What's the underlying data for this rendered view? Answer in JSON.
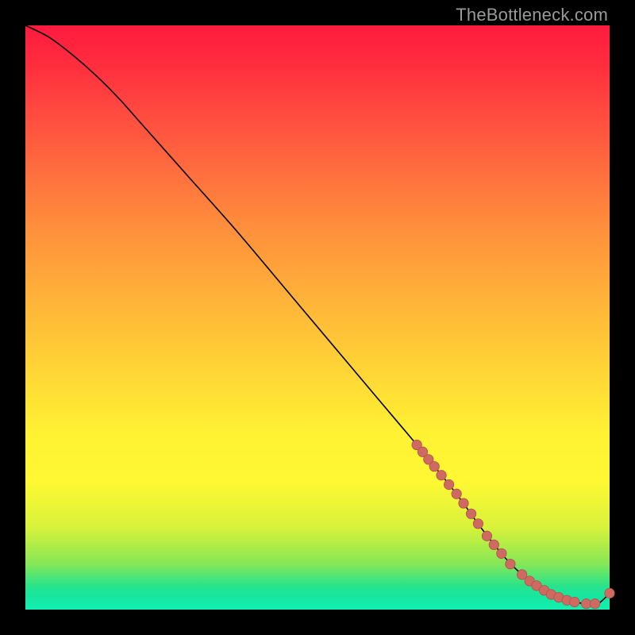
{
  "watermark": "TheBottleneck.com",
  "colors": {
    "curve": "#000000",
    "marker_fill": "#cf6a62",
    "marker_stroke": "#b15049",
    "bg_black": "#000000"
  },
  "chart_data": {
    "type": "line",
    "title": "",
    "xlabel": "",
    "ylabel": "",
    "xlim": [
      0,
      100
    ],
    "ylim": [
      0,
      100
    ],
    "grid": false,
    "legend": false,
    "series": [
      {
        "name": "bottleneck-curve",
        "x": [
          0,
          4,
          8,
          12,
          16,
          20,
          28,
          36,
          44,
          52,
          60,
          68,
          74,
          78,
          82,
          85,
          88,
          90,
          92,
          94,
          96,
          98,
          100
        ],
        "y": [
          100,
          98,
          95,
          91.5,
          87.5,
          83,
          74,
          65,
          55.5,
          46,
          36.5,
          27,
          19.5,
          14,
          9,
          6,
          3.8,
          2.6,
          1.8,
          1.3,
          1.0,
          1.0,
          2.8
        ]
      }
    ],
    "markers": [
      {
        "x": 67.0,
        "y": 28.2
      },
      {
        "x": 68.0,
        "y": 27.0
      },
      {
        "x": 69.0,
        "y": 25.7
      },
      {
        "x": 70.0,
        "y": 24.5
      },
      {
        "x": 71.2,
        "y": 23.0
      },
      {
        "x": 72.5,
        "y": 21.4
      },
      {
        "x": 73.8,
        "y": 19.8
      },
      {
        "x": 75.0,
        "y": 18.2
      },
      {
        "x": 76.3,
        "y": 16.4
      },
      {
        "x": 77.5,
        "y": 14.7
      },
      {
        "x": 79.0,
        "y": 12.6
      },
      {
        "x": 80.2,
        "y": 11.1
      },
      {
        "x": 81.5,
        "y": 9.6
      },
      {
        "x": 83.0,
        "y": 7.8
      },
      {
        "x": 85.0,
        "y": 6.0
      },
      {
        "x": 86.3,
        "y": 4.9
      },
      {
        "x": 87.5,
        "y": 4.1
      },
      {
        "x": 88.8,
        "y": 3.3
      },
      {
        "x": 90.0,
        "y": 2.6
      },
      {
        "x": 91.3,
        "y": 2.1
      },
      {
        "x": 92.7,
        "y": 1.6
      },
      {
        "x": 94.0,
        "y": 1.3
      },
      {
        "x": 96.0,
        "y": 1.0
      },
      {
        "x": 97.5,
        "y": 1.0
      },
      {
        "x": 100.0,
        "y": 2.8
      }
    ]
  }
}
